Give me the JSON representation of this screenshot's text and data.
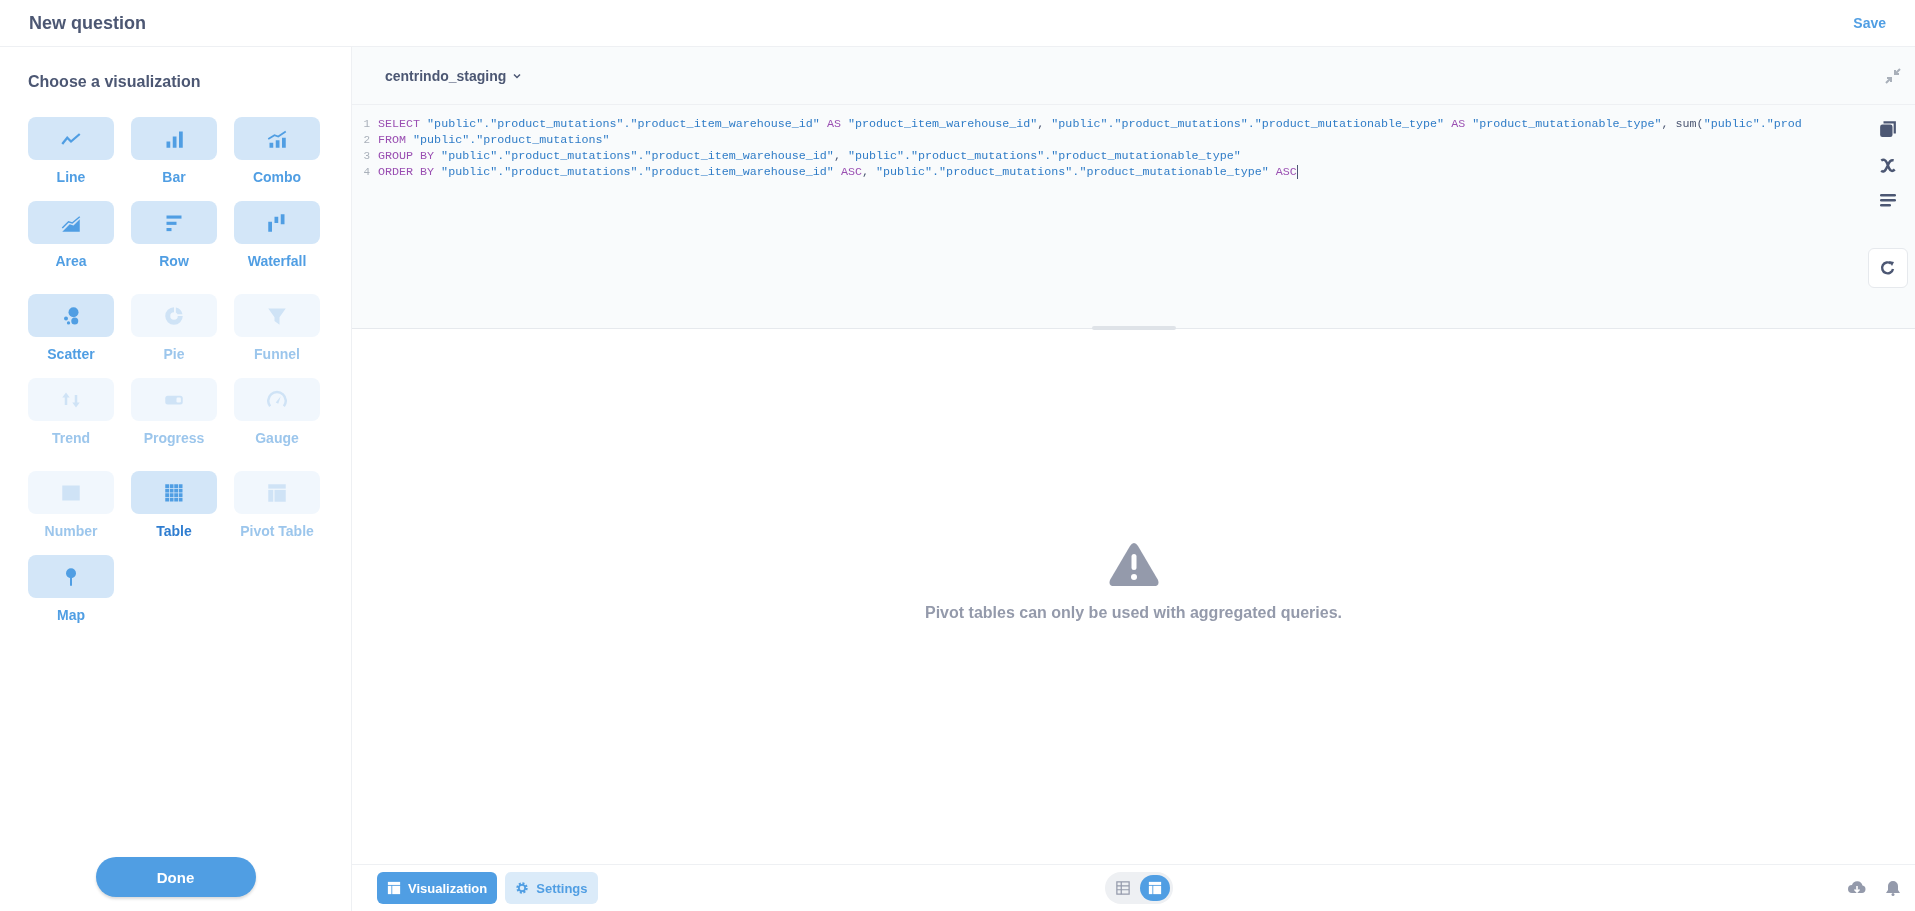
{
  "header": {
    "title": "New question",
    "save": "Save"
  },
  "sidebar": {
    "title": "Choose a visualization",
    "groups": [
      {
        "tiles": [
          {
            "kind": "line",
            "label": "Line",
            "disabled": false,
            "selected": false
          },
          {
            "kind": "bar",
            "label": "Bar",
            "disabled": false,
            "selected": false
          },
          {
            "kind": "combo",
            "label": "Combo",
            "disabled": false,
            "selected": false
          },
          {
            "kind": "area",
            "label": "Area",
            "disabled": false,
            "selected": false
          },
          {
            "kind": "row",
            "label": "Row",
            "disabled": false,
            "selected": false
          },
          {
            "kind": "waterfall",
            "label": "Waterfall",
            "disabled": false,
            "selected": false
          }
        ]
      },
      {
        "tiles": [
          {
            "kind": "scatter",
            "label": "Scatter",
            "disabled": false,
            "selected": false
          },
          {
            "kind": "pie",
            "label": "Pie",
            "disabled": true,
            "selected": false
          },
          {
            "kind": "funnel",
            "label": "Funnel",
            "disabled": true,
            "selected": false
          },
          {
            "kind": "trend",
            "label": "Trend",
            "disabled": true,
            "selected": false
          },
          {
            "kind": "progress",
            "label": "Progress",
            "disabled": true,
            "selected": false
          },
          {
            "kind": "gauge",
            "label": "Gauge",
            "disabled": true,
            "selected": false
          }
        ]
      },
      {
        "tiles": [
          {
            "kind": "number",
            "label": "Number",
            "disabled": true,
            "selected": false
          },
          {
            "kind": "table",
            "label": "Table",
            "disabled": false,
            "selected": true
          },
          {
            "kind": "pivot",
            "label": "Pivot Table",
            "disabled": true,
            "selected": false
          },
          {
            "kind": "map",
            "label": "Map",
            "disabled": false,
            "selected": false
          }
        ]
      }
    ],
    "done": "Done"
  },
  "editor": {
    "database": "centrindo_staging",
    "lines": [
      {
        "number": "1",
        "tokens": [
          {
            "kind": "keyword",
            "text": "SELECT"
          },
          {
            "kind": "string",
            "text": " \"public\".\"product_mutations\".\"product_item_warehouse_id\" "
          },
          {
            "kind": "keyword",
            "text": "AS"
          },
          {
            "kind": "string",
            "text": " \"product_item_warehouse_id\""
          },
          {
            "kind": "plain",
            "text": ", "
          },
          {
            "kind": "string",
            "text": "\"public\".\"product_mutations\".\"product_mutationable_type\" "
          },
          {
            "kind": "keyword",
            "text": "AS"
          },
          {
            "kind": "string",
            "text": " \"product_mutationable_type\""
          },
          {
            "kind": "plain",
            "text": ", sum("
          },
          {
            "kind": "string",
            "text": "\"public\".\"prod"
          }
        ]
      },
      {
        "number": "2",
        "tokens": [
          {
            "kind": "keyword",
            "text": "FROM"
          },
          {
            "kind": "string",
            "text": " \"public\".\"product_mutations\""
          }
        ]
      },
      {
        "number": "3",
        "tokens": [
          {
            "kind": "keyword",
            "text": "GROUP BY"
          },
          {
            "kind": "string",
            "text": " \"public\".\"product_mutations\".\"product_item_warehouse_id\""
          },
          {
            "kind": "plain",
            "text": ", "
          },
          {
            "kind": "string",
            "text": "\"public\".\"product_mutations\".\"product_mutationable_type\""
          }
        ]
      },
      {
        "number": "4",
        "tokens": [
          {
            "kind": "keyword",
            "text": "ORDER BY"
          },
          {
            "kind": "string",
            "text": " \"public\".\"product_mutations\".\"product_item_warehouse_id\" "
          },
          {
            "kind": "keyword",
            "text": "ASC"
          },
          {
            "kind": "plain",
            "text": ", "
          },
          {
            "kind": "string",
            "text": "\"public\".\"product_mutations\".\"product_mutationable_type\" "
          },
          {
            "kind": "keyword",
            "text": "ASC"
          }
        ]
      }
    ]
  },
  "message": "Pivot tables can only be used with aggregated queries.",
  "footer": {
    "buttons": [
      {
        "kind": "visualization",
        "label": "Visualization",
        "selected": true
      },
      {
        "kind": "settings",
        "label": "Settings",
        "selected": false
      }
    ],
    "view_toggle": [
      {
        "kind": "table",
        "selected": false
      },
      {
        "kind": "pivot",
        "selected": true
      }
    ]
  }
}
